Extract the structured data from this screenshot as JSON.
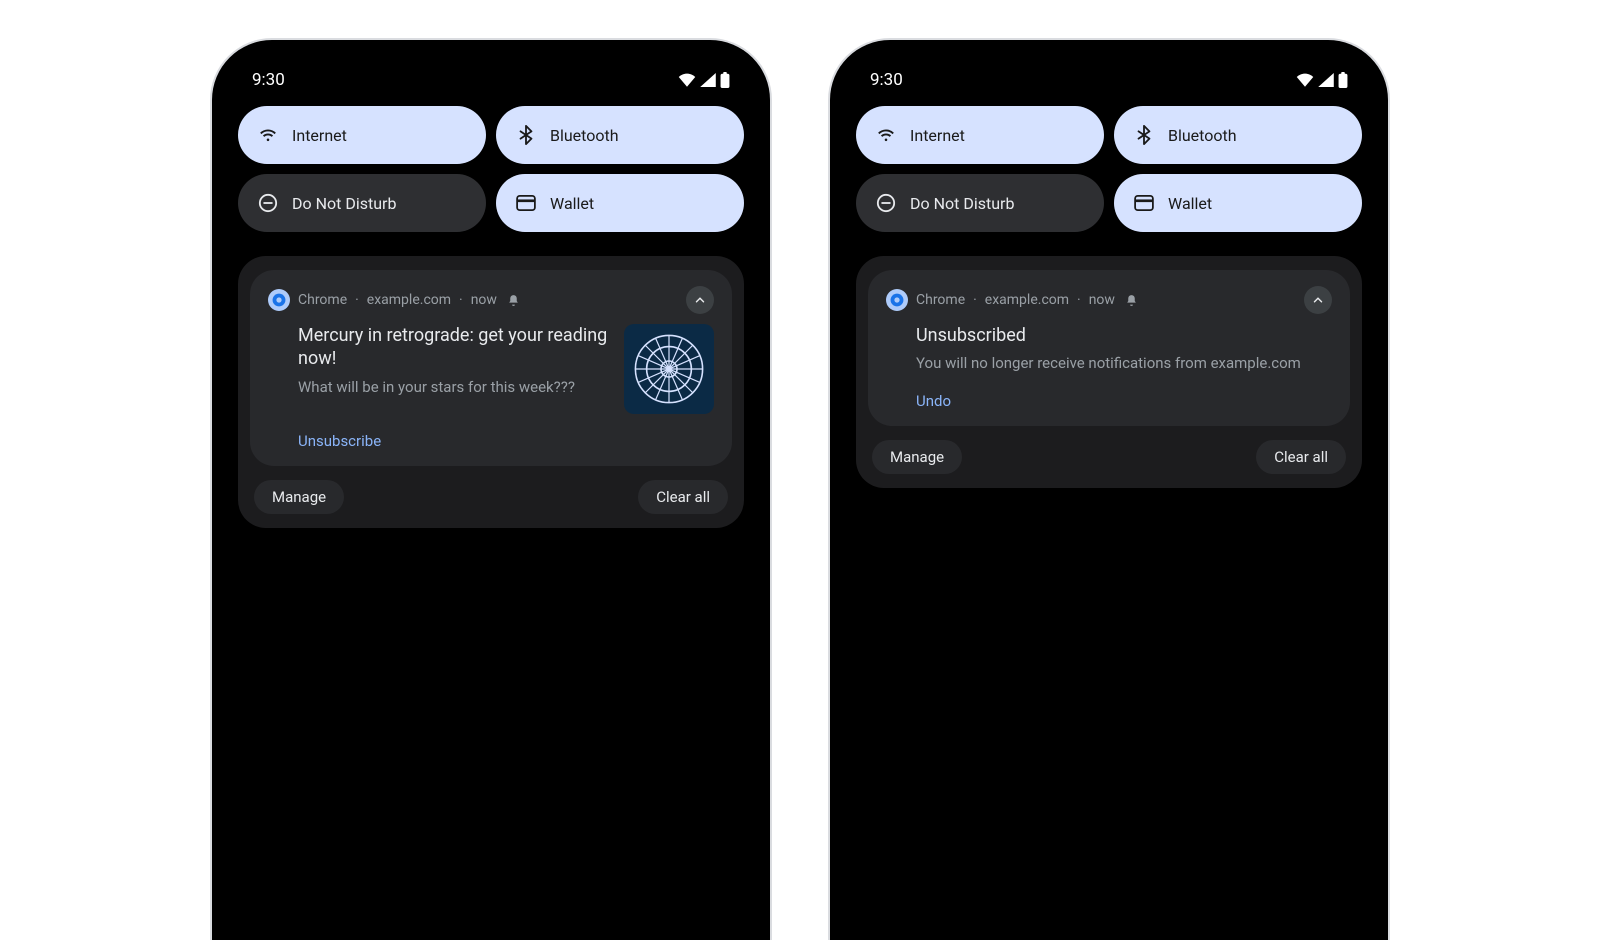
{
  "status_time": "9:30",
  "qs_tiles": [
    {
      "label": "Internet",
      "icon": "wifi-icon",
      "active": true
    },
    {
      "label": "Bluetooth",
      "icon": "bluetooth-icon",
      "active": true
    },
    {
      "label": "Do Not Disturb",
      "icon": "dnd-icon",
      "active": false
    },
    {
      "label": "Wallet",
      "icon": "wallet-icon",
      "active": true
    }
  ],
  "shade": {
    "manage_label": "Manage",
    "clear_all_label": "Clear all"
  },
  "phone1": {
    "notif": {
      "app": "Chrome",
      "site": "example.com",
      "time": "now",
      "title": "Mercury in retrograde: get your reading now!",
      "body": "What will be in your stars for this week???",
      "action": "Unsubscribe",
      "has_thumb": true
    }
  },
  "phone2": {
    "notif": {
      "app": "Chrome",
      "site": "example.com",
      "time": "now",
      "title": "Unsubscribed",
      "body": "You will no longer receive notifications from example.com",
      "action": "Undo",
      "has_thumb": false
    }
  },
  "colors": {
    "tile_active": "#d6e2ff",
    "tile_inactive": "#2e2f32",
    "accent": "#8ab4f8"
  }
}
